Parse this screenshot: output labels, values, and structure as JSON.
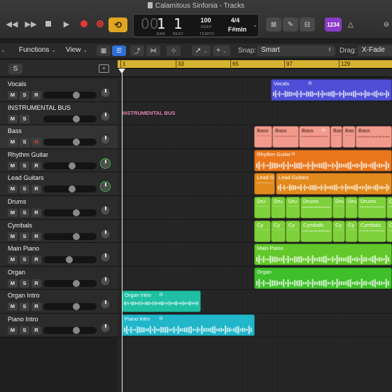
{
  "window": {
    "title": "Calamitous Sinfonia - Tracks"
  },
  "transport": {
    "bar": "1",
    "beat": "1",
    "bar_label": "BAR",
    "beat_label": "BEAT",
    "tempo": "100",
    "tempo_sub": "KEEP",
    "tempo_label": "TEMPO",
    "signature": "4/4",
    "key": "F#min",
    "counter_badge": "1234"
  },
  "toolbar": {
    "functions_label": "Functions",
    "view_label": "View",
    "snap_label": "Snap:",
    "snap_value": "Smart",
    "drag_label": "Drag:",
    "drag_value": "X-Fade"
  },
  "header": {
    "s_label": "S"
  },
  "ruler": {
    "marks": [
      "1",
      "33",
      "65",
      "97",
      "129"
    ]
  },
  "bus_label": "INSTRUMENTAL BUS",
  "tracks": [
    {
      "name": "Vocals",
      "m": "M",
      "s": "S",
      "r": "R",
      "volume": 0.64,
      "pan_green": false
    },
    {
      "name": "INSTRUMENTAL BUS",
      "m": "M",
      "s": "S",
      "r": "",
      "volume": 0.64,
      "pan_green": false
    },
    {
      "name": "Bass",
      "m": "M",
      "s": "S",
      "r": "R",
      "volume": 0.64,
      "pan_green": false
    },
    {
      "name": "Rhythm Guitar",
      "m": "M",
      "s": "S",
      "r": "R",
      "volume": 0.55,
      "pan_green": true
    },
    {
      "name": "Lead Guitars",
      "m": "M",
      "s": "S",
      "r": "R",
      "volume": 0.55,
      "pan_green": true
    },
    {
      "name": "Drums",
      "m": "M",
      "s": "S",
      "r": "R",
      "volume": 0.64,
      "pan_green": false
    },
    {
      "name": "Cymbals",
      "m": "M",
      "s": "S",
      "r": "R",
      "volume": 0.64,
      "pan_green": false
    },
    {
      "name": "Main Piano",
      "m": "M",
      "s": "S",
      "r": "R",
      "volume": 0.48,
      "pan_green": false
    },
    {
      "name": "Organ",
      "m": "M",
      "s": "S",
      "r": "R",
      "volume": 0.64,
      "pan_green": false
    },
    {
      "name": "Organ Intro",
      "m": "M",
      "s": "S",
      "r": "R",
      "volume": 0.64,
      "pan_green": false
    },
    {
      "name": "Piano Intro",
      "m": "M",
      "s": "S",
      "r": "R",
      "volume": 0.64,
      "pan_green": false
    }
  ],
  "regions": {
    "vocals": [
      "Vocals"
    ],
    "bass": [
      "Bass",
      "Bass",
      "Bass",
      "Bas",
      "Bas",
      "Bass"
    ],
    "rhythm": [
      "Rhythm Guitar"
    ],
    "lead": [
      "Lead G",
      "Lead Guitars"
    ],
    "drums": [
      "Dru",
      "Dru",
      "Dru",
      "Drums",
      "Dru",
      "Dru",
      "Drums",
      "Dru"
    ],
    "cymbals": [
      "Cy",
      "Cy",
      "Cy",
      "Cymbals",
      "Cy",
      "Cy",
      "Cymbals",
      "Cy"
    ],
    "main_piano": [
      "Main Piano"
    ],
    "organ": [
      "Organ"
    ],
    "organ_intro": [
      "Organ Intro"
    ],
    "piano_intro": [
      "Piano Intro"
    ]
  },
  "colors": {
    "vocals": "#4e4fd6",
    "bass": "#f29a8c",
    "rhythm": "#e9761c",
    "lead": "#e38a1d",
    "drums": "#7fd13b",
    "cymbals": "#7fd13b",
    "main_piano": "#63c92b",
    "organ": "#3fbf2a",
    "organ_intro": "#1fbfa3",
    "piano_intro": "#21b6c9",
    "cycle": "#e0a622",
    "ruler": "#d6b230"
  },
  "icons": [
    "rewind-icon",
    "fast-forward-icon",
    "stop-icon",
    "play-icon",
    "record-icon",
    "capture-record-icon",
    "cycle-icon",
    "pointer-tool-icon",
    "marquee-tool-icon"
  ]
}
